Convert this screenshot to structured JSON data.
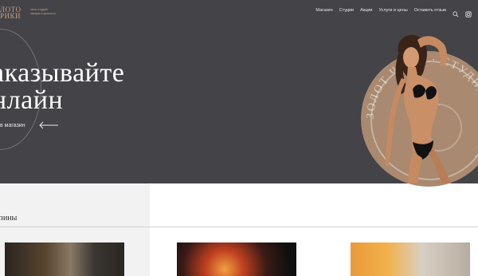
{
  "logo": {
    "main": "ЛОТО\nРИКИ",
    "sub": "сеть студий\nзагара и красоты"
  },
  "nav": {
    "items": [
      "Магазин",
      "Студии",
      "Акции",
      "Услуги и цены",
      "Оставить отзыв"
    ],
    "search_icon": "search-icon",
    "instagram_icon": "instagram-icon"
  },
  "hero": {
    "title": "аказывайте\nнлайн",
    "link": "в магазин",
    "stamp_text": "ЗОЛОТ  ЧИКИ · СТУДИЯ ЗАГАРА ·"
  },
  "section": {
    "title": "зины"
  },
  "cards": [
    {
      "label": ""
    },
    {
      "label": ""
    },
    {
      "label": ""
    }
  ],
  "colors": {
    "hero_bg": "#434348",
    "accent": "#c9a27c",
    "stamp": "#a9896f"
  }
}
